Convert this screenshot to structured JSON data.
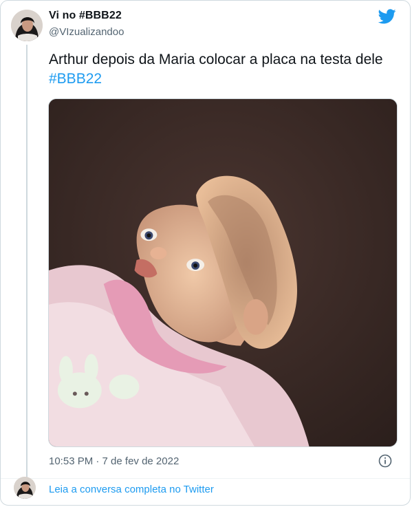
{
  "tweet": {
    "author_name": "Vi no #BBB22",
    "author_handle": "@VIzualizandoo",
    "text_main": "Arthur depois da Maria colocar a placa na testa dele ",
    "text_hashtag": "#BBB22",
    "timestamp": "10:53 PM · 7 de fev de 2022",
    "media_description": "Photo of a doll"
  },
  "footer": {
    "read_conversation": "Leia a conversa completa no Twitter"
  },
  "colors": {
    "accent": "#1d9bf0",
    "text": "#0f1419",
    "secondary": "#536471",
    "border": "#cfd9de"
  },
  "icons": {
    "brand": "twitter-bird-icon",
    "info": "info-icon"
  }
}
